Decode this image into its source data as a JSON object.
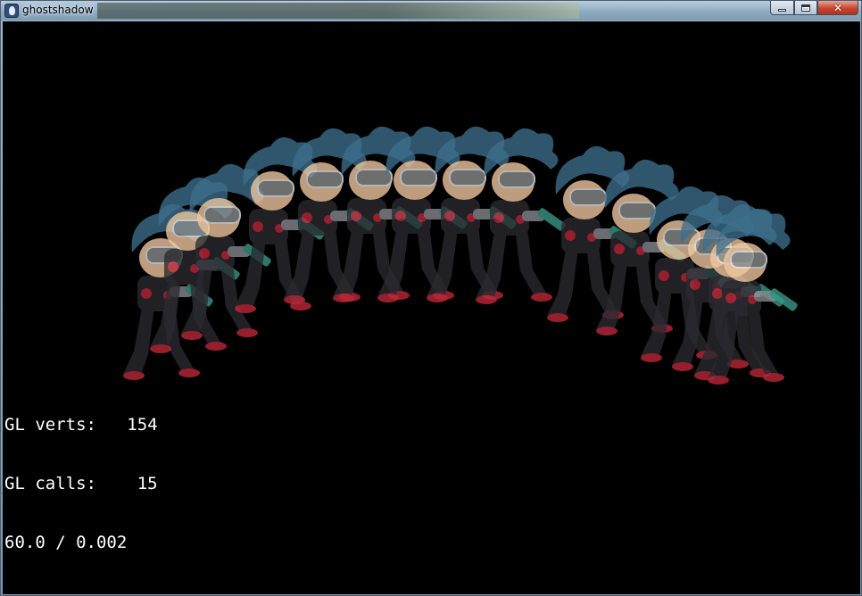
{
  "window": {
    "title": "ghostshadow"
  },
  "stats": {
    "line1": "GL verts:   154",
    "line2": "GL calls:    15",
    "line3": "60.0 / 0.002"
  },
  "colors": {
    "canvas_bg": "#000000",
    "hair": "#3d6f8c",
    "skin": "#f2c9a0",
    "suit": "#2a2a30",
    "accent": "#c0283a",
    "gun": "#3a9a88"
  },
  "icons": {
    "app": "app-icon",
    "minimize": "minimize-icon",
    "maximize": "maximize-icon",
    "close": "close-icon"
  },
  "scene": {
    "sprite_count": 15
  }
}
